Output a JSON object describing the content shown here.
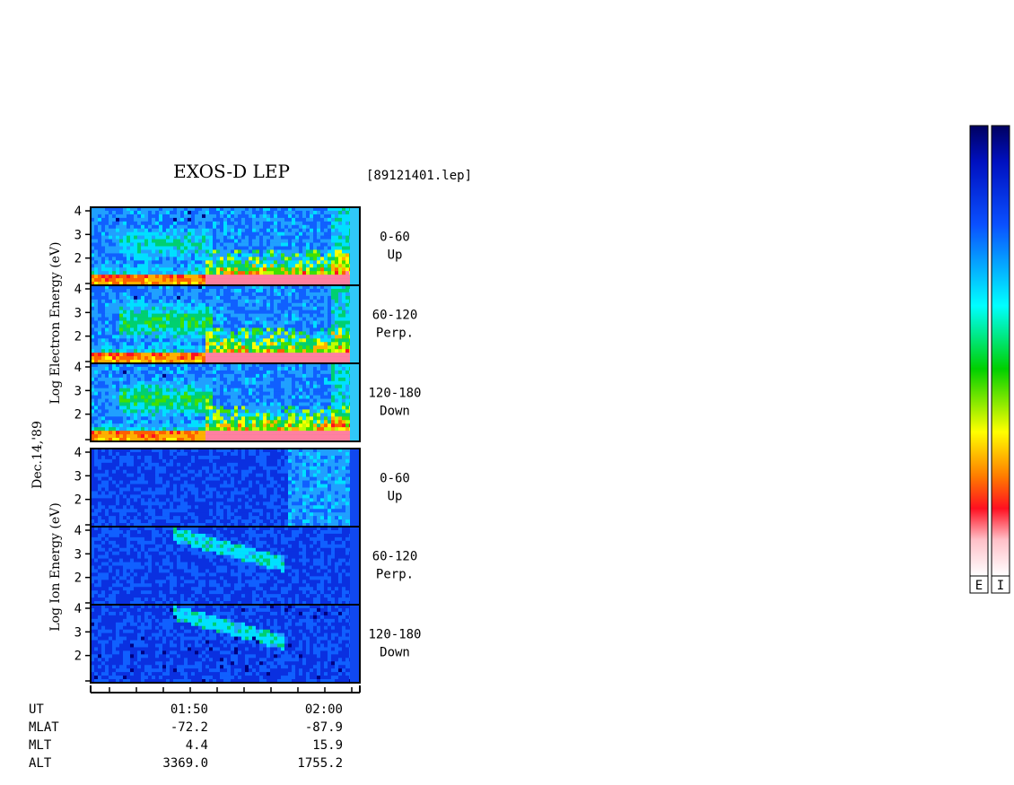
{
  "title": "EXOS-D LEP",
  "file_label": "[89121401.lep]",
  "date_label": "Dec.14,'89",
  "electron_ylabel": "Log  Electron  Energy (eV)",
  "ion_ylabel": "Log  Ion  Energy (eV)",
  "colorbar_labels": [
    "E",
    "I"
  ],
  "colors": {
    "bg": "#ffffff",
    "frame": "#000000",
    "base_blue": "#0a2fd0"
  },
  "chart_data": {
    "type": "heatmap",
    "panels": [
      {
        "species": "Electron",
        "angle": "0-60",
        "direction": "Up"
      },
      {
        "species": "Electron",
        "angle": "60-120",
        "direction": "Perp."
      },
      {
        "species": "Electron",
        "angle": "120-180",
        "direction": "Down"
      },
      {
        "species": "Ion",
        "angle": "0-60",
        "direction": "Up"
      },
      {
        "species": "Ion",
        "angle": "60-120",
        "direction": "Perp."
      },
      {
        "species": "Ion",
        "angle": "120-180",
        "direction": "Down"
      }
    ],
    "y_ticks": [
      "4",
      "3",
      "2"
    ],
    "ylim_log_eV": [
      1,
      4
    ],
    "x_ticks": [
      "01:50",
      "02:00"
    ],
    "orbit_labels": [
      "UT",
      "MLAT",
      "MLT",
      "ALT"
    ],
    "orbit_values": {
      "01:50": {
        "MLAT": "-72.2",
        "MLT": "4.4",
        "ALT": "3369.0"
      },
      "02:00": {
        "MLAT": "-87.9",
        "MLT": "15.9",
        "ALT": "1755.2"
      }
    },
    "colorbar": {
      "scale": [
        "white",
        "pink",
        "red",
        "orange",
        "yellow",
        "green",
        "cyan",
        "blue",
        "navy"
      ]
    }
  }
}
